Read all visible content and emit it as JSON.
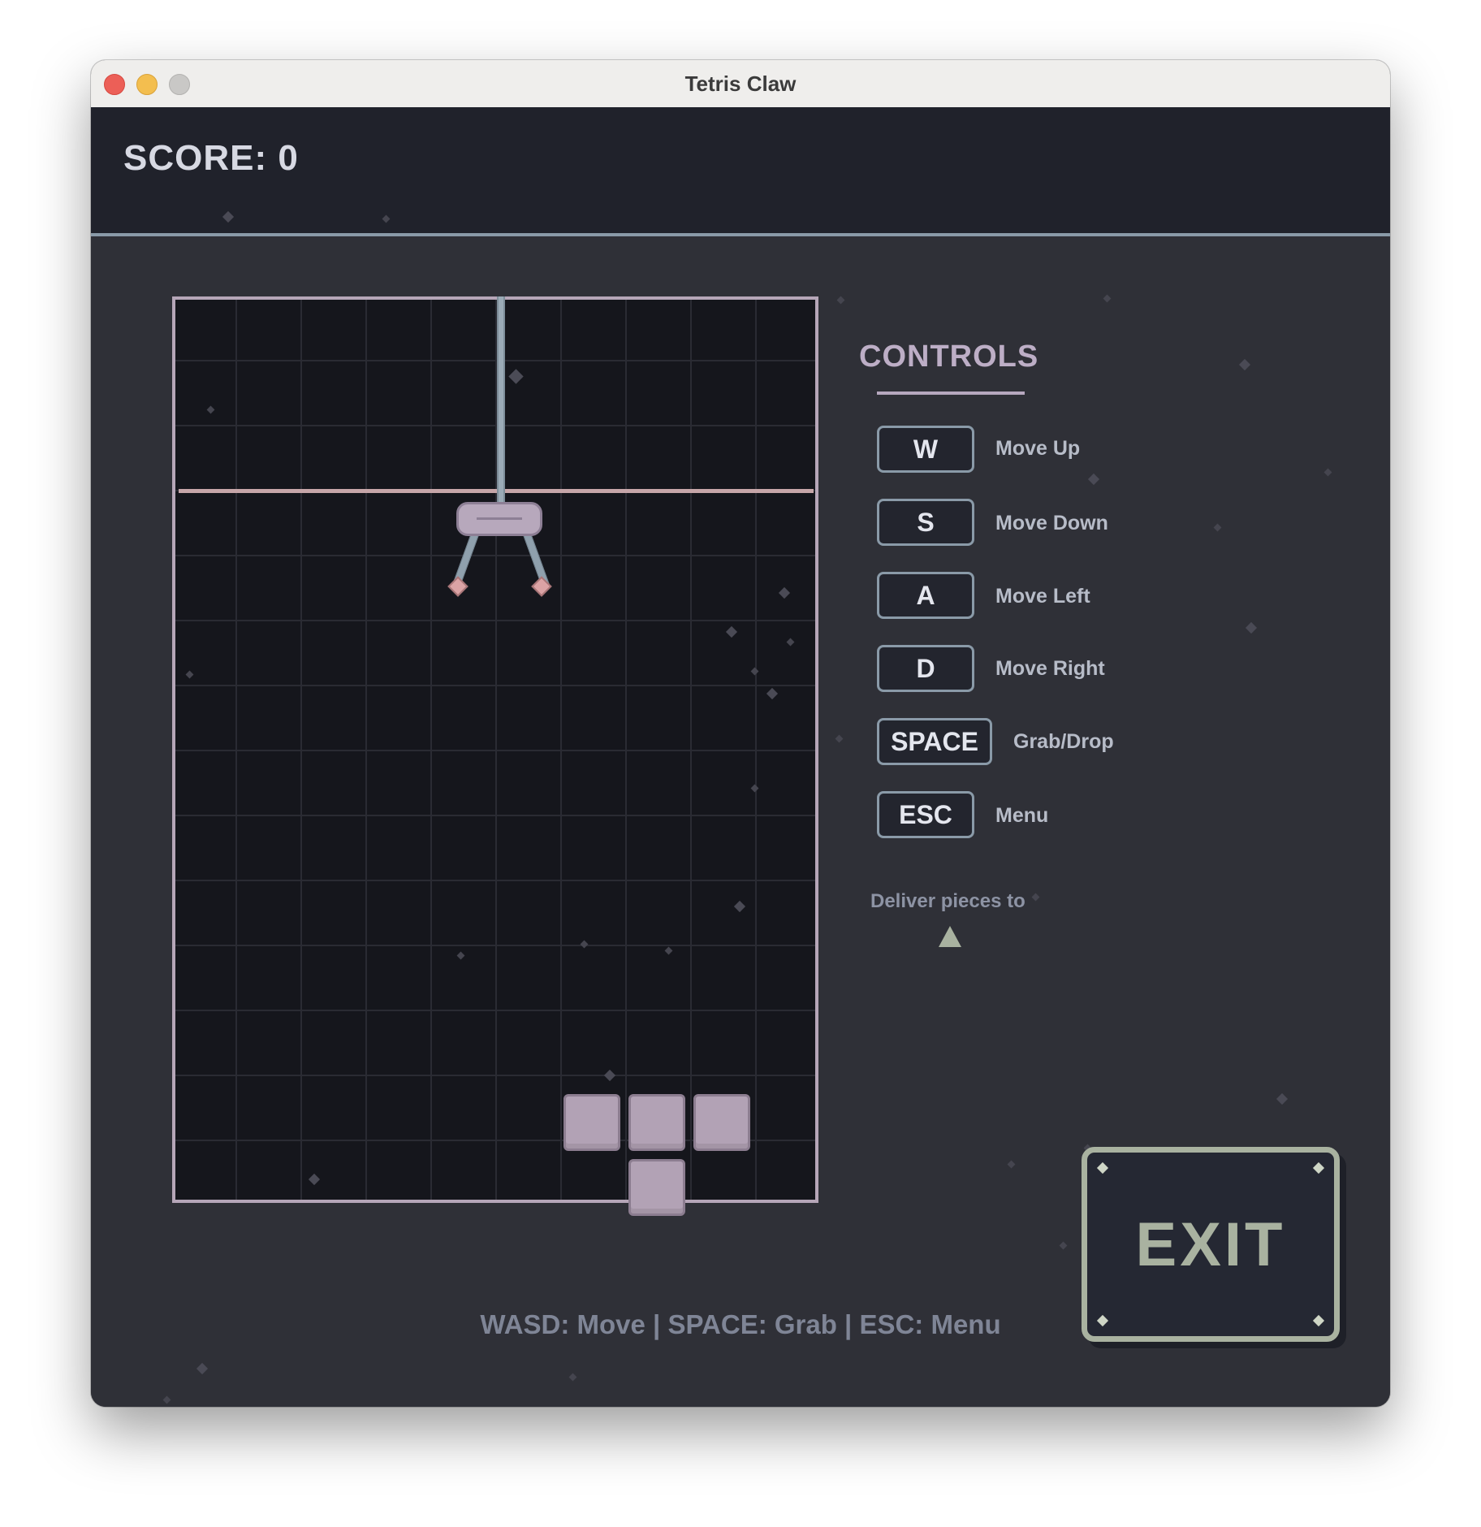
{
  "window": {
    "title": "Tetris Claw"
  },
  "hud": {
    "score": "SCORE: 0"
  },
  "controls": {
    "title": "CONTROLS",
    "items": [
      {
        "key": "W",
        "label": "Move Up"
      },
      {
        "key": "S",
        "label": "Move Down"
      },
      {
        "key": "A",
        "label": "Move Left"
      },
      {
        "key": "D",
        "label": "Move Right"
      },
      {
        "key": "SPACE",
        "label": "Grab/Drop"
      },
      {
        "key": "ESC",
        "label": "Menu"
      }
    ],
    "deliver_text": "Deliver pieces to"
  },
  "exit_button": {
    "label": "EXIT"
  },
  "footer": {
    "hint": "WASD: Move | SPACE: Grab | ESC: Menu"
  },
  "colors": {
    "background": "#2f3037",
    "board": "#15161c",
    "piece": "#b2a2b5",
    "accent": "#a9b2a0",
    "frame": "#8a9aa8"
  }
}
